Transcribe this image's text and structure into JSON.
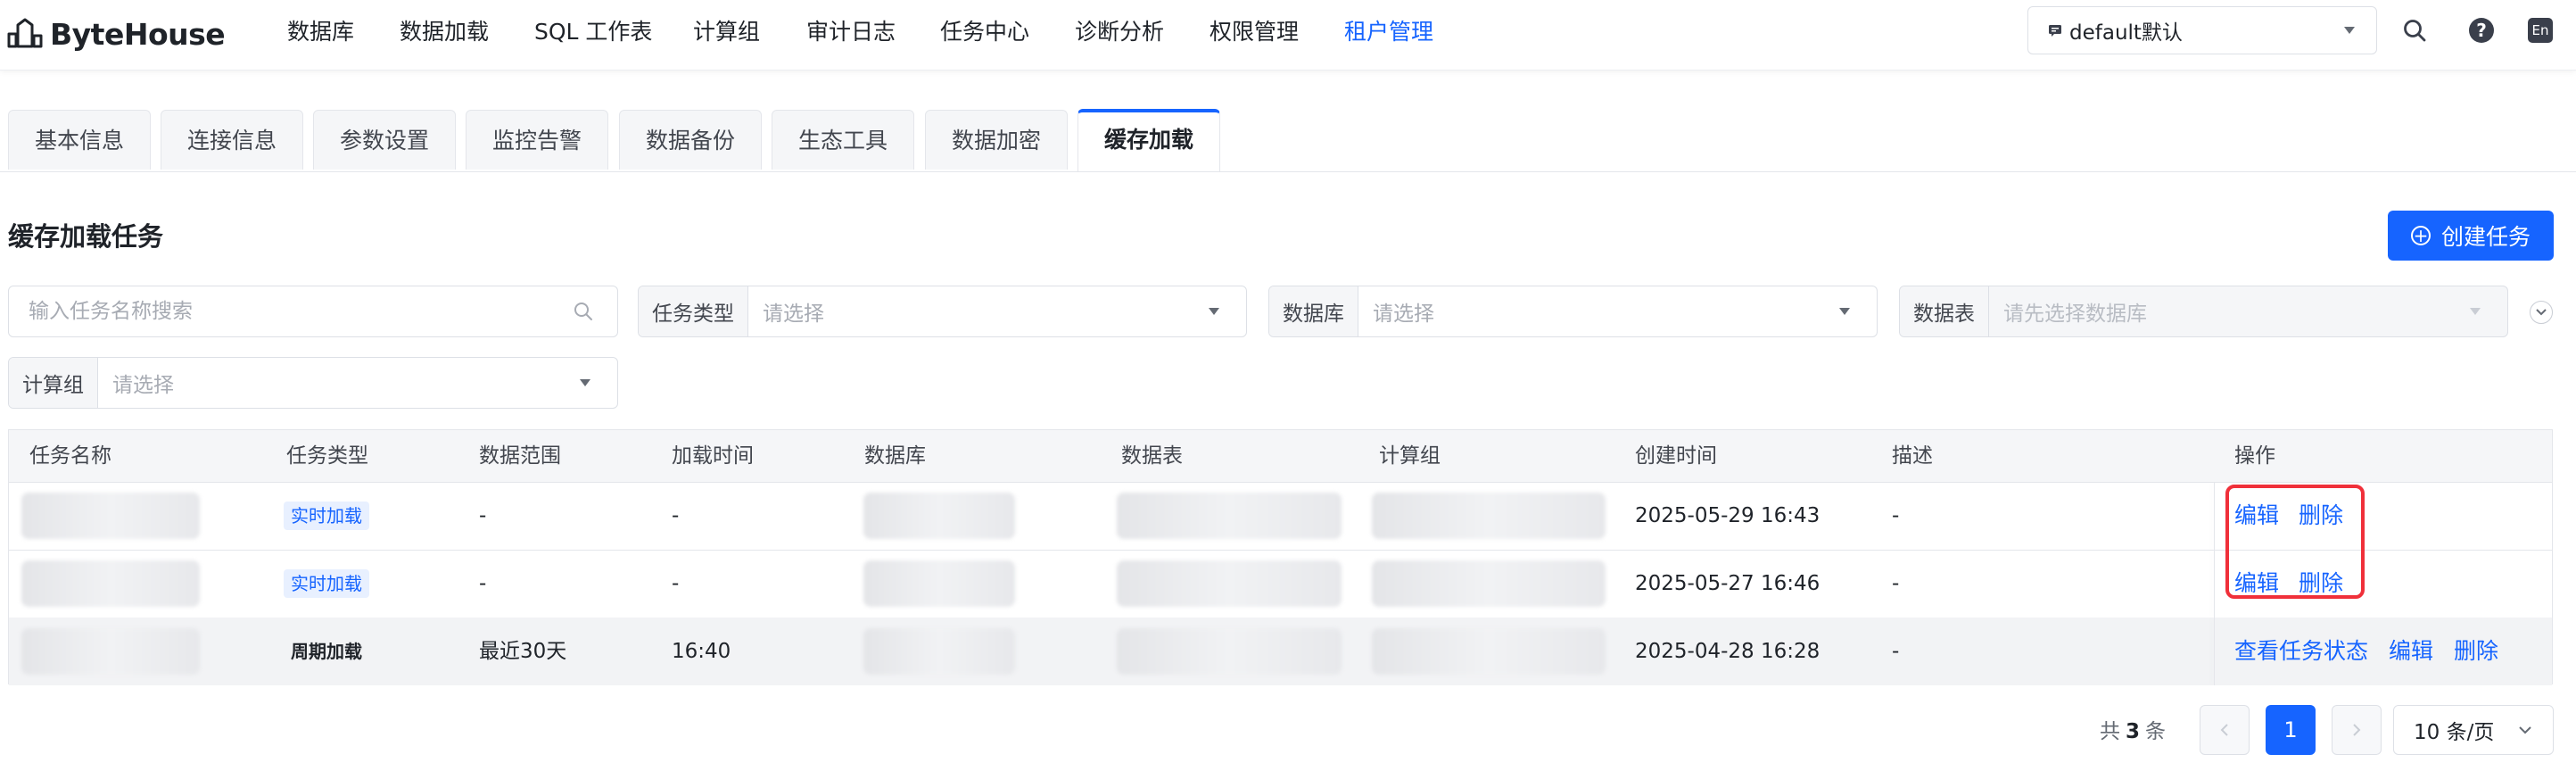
{
  "app": {
    "logo_text": "ByteHouse"
  },
  "nav": {
    "items": [
      "数据库",
      "数据加载",
      "SQL 工作表",
      "计算组",
      "审计日志",
      "任务中心",
      "诊断分析",
      "权限管理",
      "租户管理"
    ],
    "active_index": 8
  },
  "tenant": {
    "value": "default默认"
  },
  "topbar": {
    "lang_label": "En",
    "help_label": "?"
  },
  "tabs": {
    "items": [
      "基本信息",
      "连接信息",
      "参数设置",
      "监控告警",
      "数据备份",
      "生态工具",
      "数据加密",
      "缓存加载"
    ],
    "active_index": 7
  },
  "section": {
    "title": "缓存加载任务",
    "create_label": "创建任务"
  },
  "filters": {
    "search_placeholder": "输入任务名称搜索",
    "task_type": {
      "label": "任务类型",
      "placeholder": "请选择"
    },
    "database": {
      "label": "数据库",
      "placeholder": "请选择"
    },
    "table": {
      "label": "数据表",
      "placeholder": "请先选择数据库"
    },
    "compute_group": {
      "label": "计算组",
      "placeholder": "请选择"
    }
  },
  "table": {
    "columns": [
      "任务名称",
      "任务类型",
      "数据范围",
      "加载时间",
      "数据库",
      "数据表",
      "计算组",
      "创建时间",
      "描述",
      "操作"
    ],
    "rows": [
      {
        "task_type": "实时加载",
        "range": "-",
        "load_time": "-",
        "created": "2025-05-29 16:43",
        "desc": "-"
      },
      {
        "task_type": "实时加载",
        "range": "-",
        "load_time": "-",
        "created": "2025-05-27 16:46",
        "desc": "-"
      },
      {
        "task_type": "周期加载",
        "range": "最近30天",
        "load_time": "16:40",
        "created": "2025-04-28 16:28",
        "desc": "-"
      }
    ],
    "actions": {
      "view_status": "查看任务状态",
      "edit": "编辑",
      "delete": "删除"
    }
  },
  "pagination": {
    "total_prefix": "共",
    "total": "3",
    "total_suffix": "条",
    "current_page": "1",
    "page_size": "10 条/页"
  },
  "colors": {
    "primary": "#1664ff",
    "highlight": "#f0303a",
    "tag_bg": "#e8f0ff"
  },
  "icons": [
    "logo-icon",
    "search-icon",
    "help-icon",
    "language-icon",
    "caret-down-icon",
    "plus-circle-icon",
    "chevron-left-icon",
    "chevron-right-icon",
    "chevron-down-icon",
    "tenant-icon"
  ]
}
